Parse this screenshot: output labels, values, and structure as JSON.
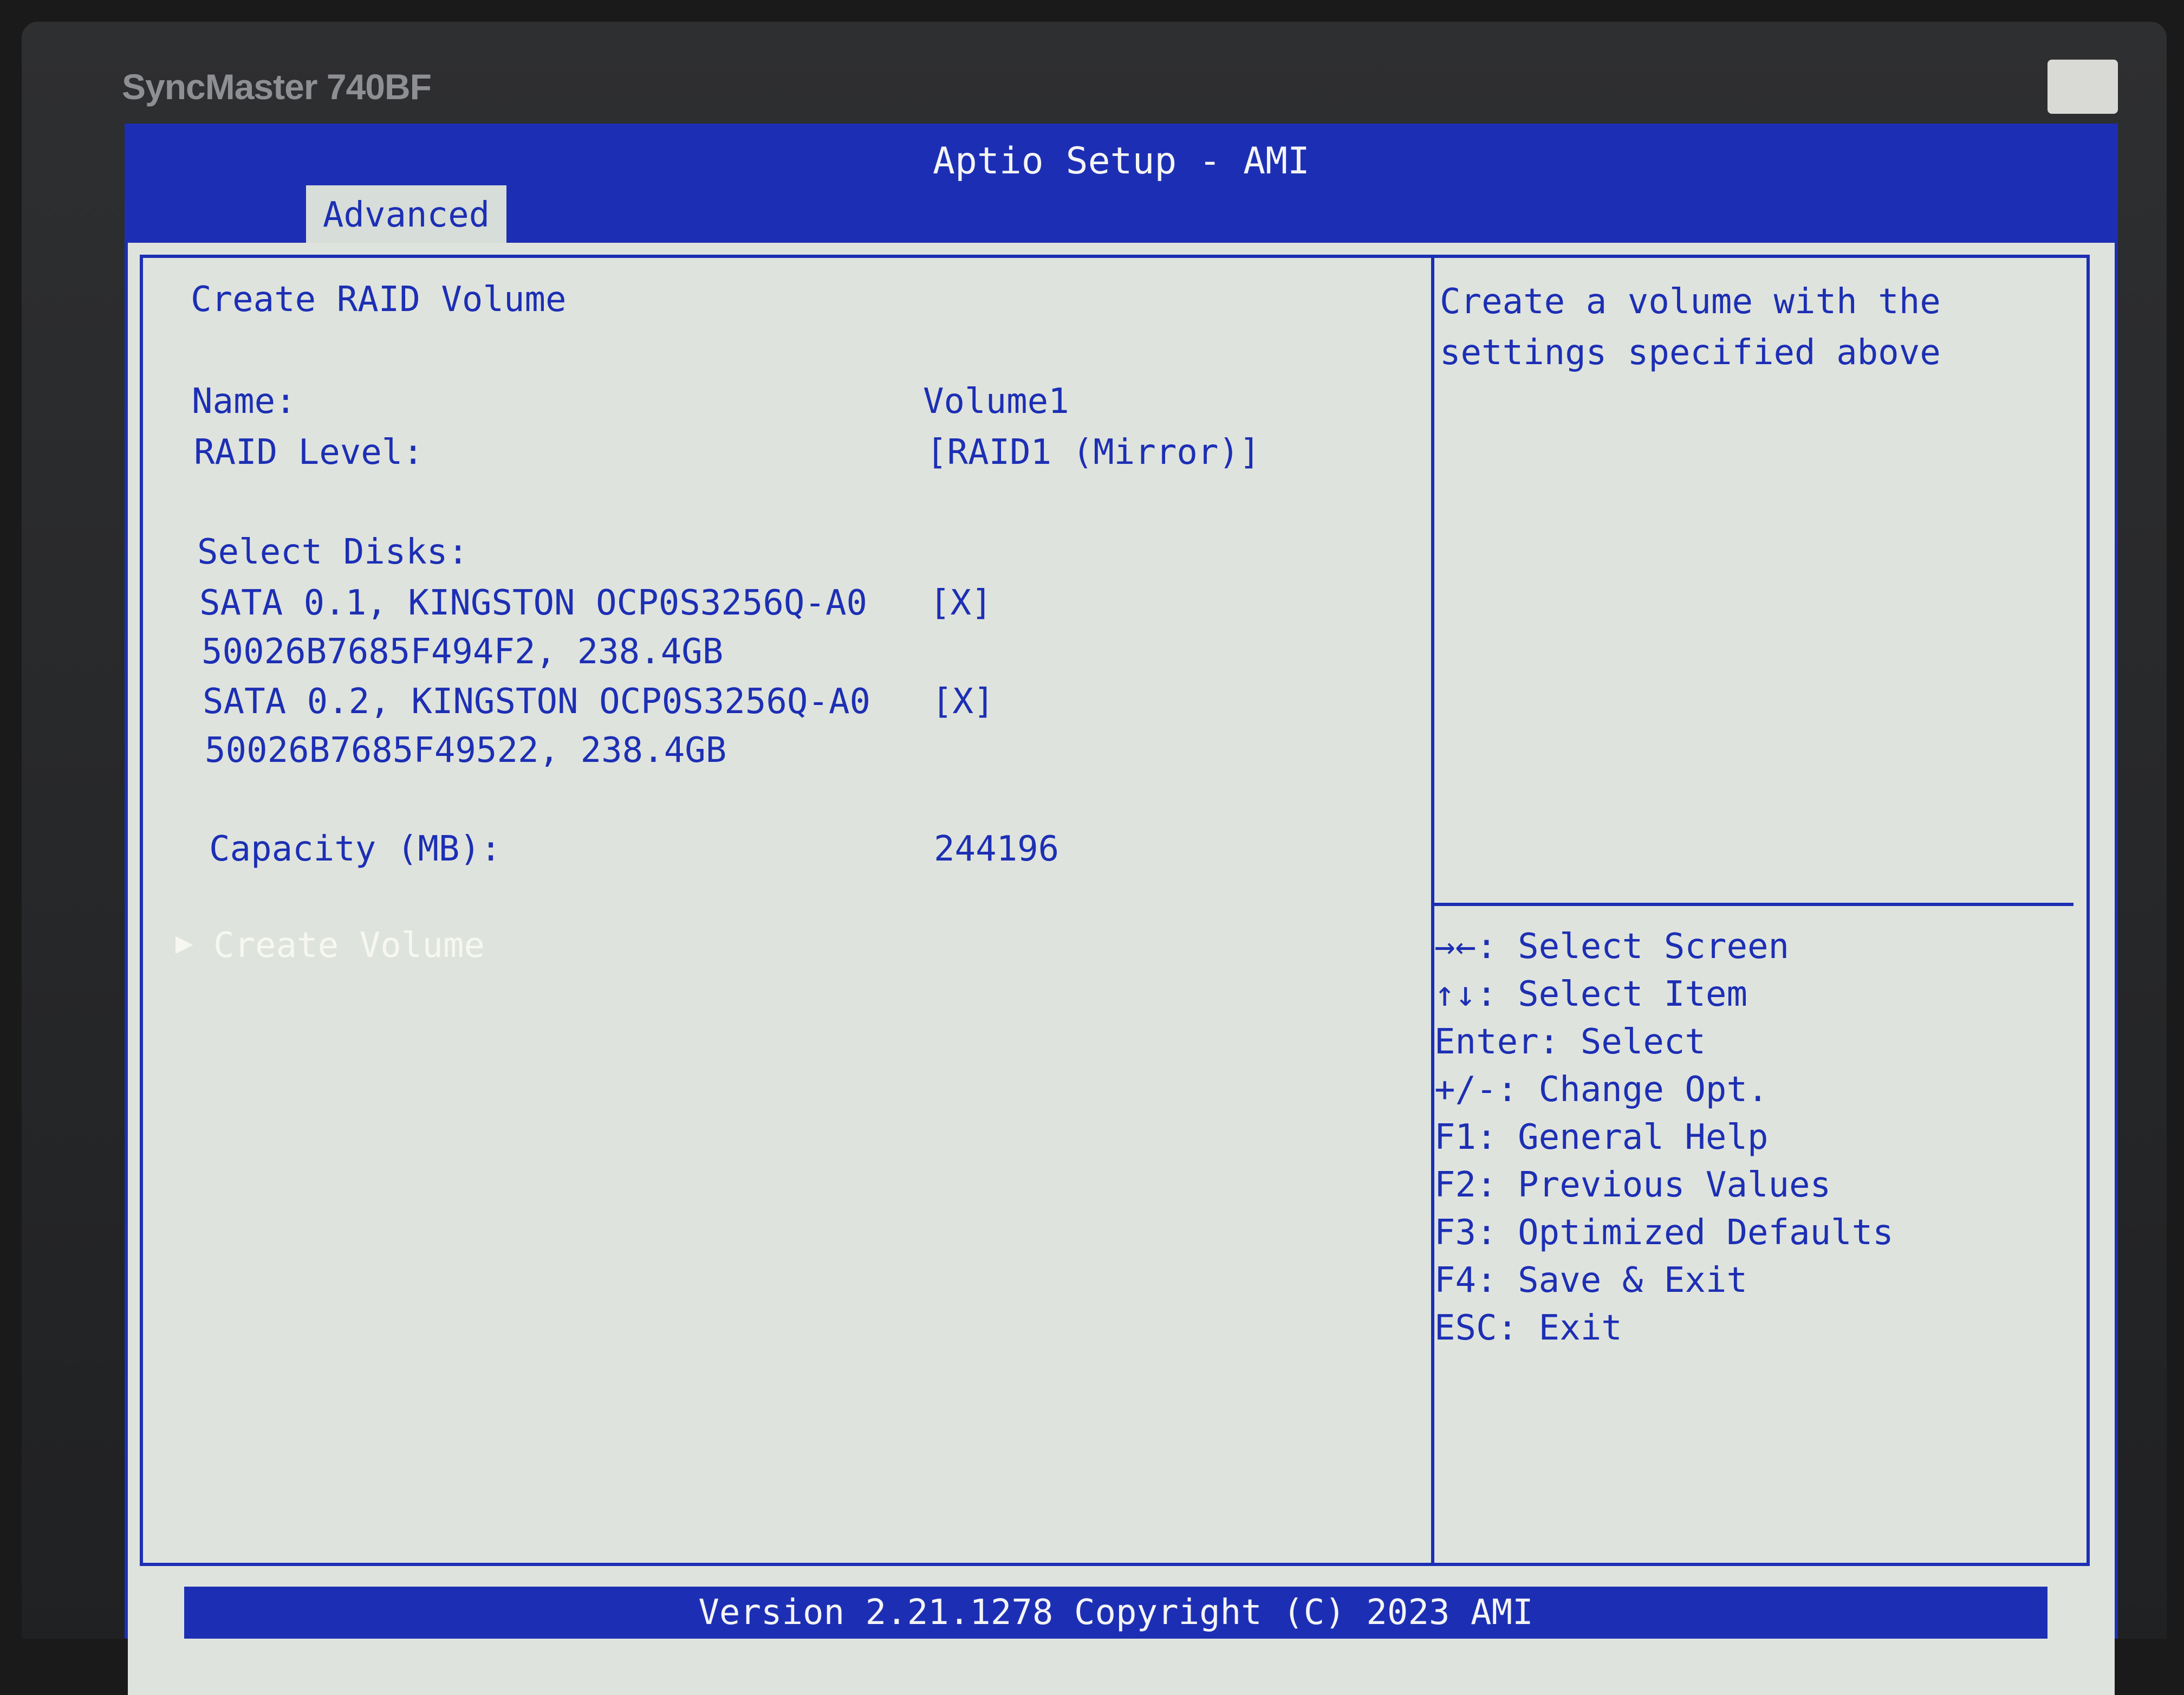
{
  "monitor": {
    "brand": "SyncMaster 740BF"
  },
  "bios": {
    "title": "Aptio Setup - AMI",
    "tabs": [
      {
        "label": "Advanced",
        "active": true
      }
    ],
    "page_title": "Create RAID Volume",
    "fields": {
      "name": {
        "label": "Name:",
        "value": "Volume1"
      },
      "raid_level": {
        "label": "RAID Level:",
        "value": "[RAID1 (Mirror)]"
      }
    },
    "select_disks": {
      "label": "Select Disks:",
      "disks": [
        {
          "line1": "SATA 0.1, KINGSTON OCP0S3256Q-A0",
          "line2": "50026B7685F494F2, 238.4GB",
          "checkbox": "[X]"
        },
        {
          "line1": "SATA 0.2, KINGSTON OCP0S3256Q-A0",
          "line2": "50026B7685F49522, 238.4GB",
          "checkbox": "[X]"
        }
      ]
    },
    "capacity": {
      "label": "Capacity (MB):",
      "value": "244196"
    },
    "action": {
      "arrow": "▶",
      "label": "Create Volume"
    },
    "help_text": [
      "Create a volume with the",
      "settings specified above"
    ],
    "keys": [
      "→←: Select Screen",
      "↑↓: Select Item",
      "Enter: Select",
      "+/-: Change Opt.",
      "F1: General Help",
      "F2: Previous Values",
      "F3: Optimized Defaults",
      "F4: Save & Exit",
      "ESC: Exit"
    ],
    "footer": "Version 2.21.1278 Copyright (C) 2023 AMI"
  },
  "colors": {
    "bios_blue": "#1c2fb4",
    "panel_bg": "#dfe3dd",
    "highlight": "#f7f7f1",
    "bezel": "#2e2f31"
  }
}
